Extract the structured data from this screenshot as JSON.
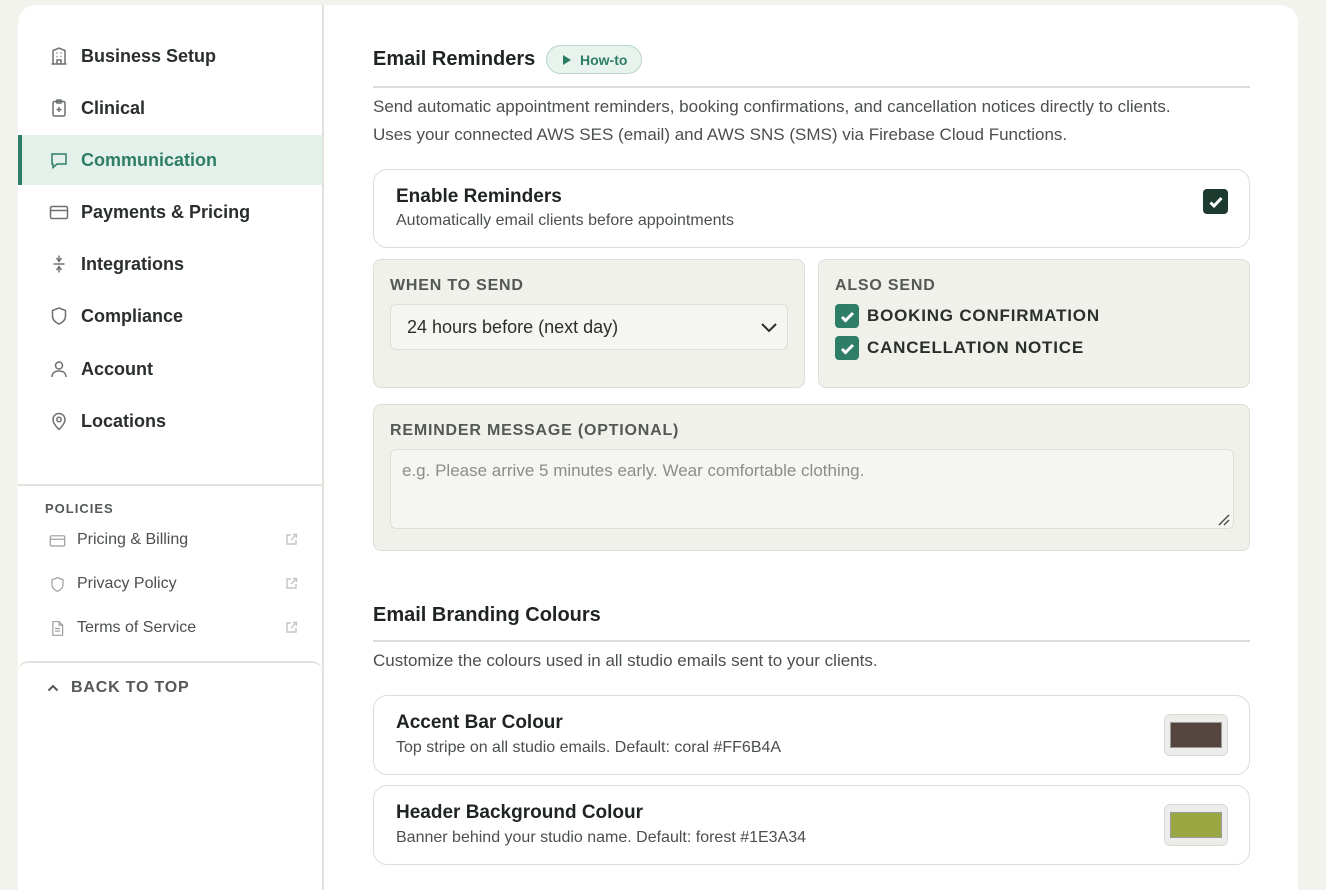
{
  "sidebar": {
    "items": [
      {
        "label": "Business Setup",
        "icon": "building-icon"
      },
      {
        "label": "Clinical",
        "icon": "clipboard-icon"
      },
      {
        "label": "Communication",
        "icon": "chat-icon"
      },
      {
        "label": "Payments & Pricing",
        "icon": "credit-card-icon"
      },
      {
        "label": "Integrations",
        "icon": "plug-icon"
      },
      {
        "label": "Compliance",
        "icon": "shield-icon"
      },
      {
        "label": "Account",
        "icon": "user-icon"
      },
      {
        "label": "Locations",
        "icon": "map-pin-icon"
      }
    ],
    "active_index": 2,
    "policies_title": "POLICIES",
    "policies": [
      {
        "label": "Pricing & Billing",
        "icon": "credit-card-icon"
      },
      {
        "label": "Privacy Policy",
        "icon": "shield-icon"
      },
      {
        "label": "Terms of Service",
        "icon": "document-icon"
      }
    ],
    "back_to_top": "BACK TO TOP"
  },
  "reminders": {
    "title": "Email Reminders",
    "howto": "How-to",
    "desc_line1": "Send automatic appointment reminders, booking confirmations, and cancellation notices directly to clients.",
    "desc_line2": "Uses your connected AWS SES (email) and AWS SNS (SMS) via Firebase Cloud Functions.",
    "enable_title": "Enable Reminders",
    "enable_sub": "Automatically email clients before appointments",
    "enabled": true,
    "when_label": "WHEN TO SEND",
    "when_value": "24 hours before (next day)",
    "also_label": "ALSO SEND",
    "also_items": [
      {
        "label": "BOOKING CONFIRMATION",
        "checked": true
      },
      {
        "label": "CANCELLATION NOTICE",
        "checked": true
      }
    ],
    "message_label": "REMINDER MESSAGE (OPTIONAL)",
    "message_placeholder": "e.g. Please arrive 5 minutes early. Wear comfortable clothing."
  },
  "branding": {
    "title": "Email Branding Colours",
    "desc": "Customize the colours used in all studio emails sent to your clients.",
    "rows": [
      {
        "title": "Accent Bar Colour",
        "sub": "Top stripe on all studio emails. Default: coral #FF6B4A",
        "color": "#54453F"
      },
      {
        "title": "Header Background Colour",
        "sub": "Banner behind your studio name. Default: forest #1E3A34",
        "color": "#99A642"
      }
    ]
  },
  "colors": {
    "accent": "#2E7D67",
    "checkbox_dark": "#1D3A2F"
  }
}
